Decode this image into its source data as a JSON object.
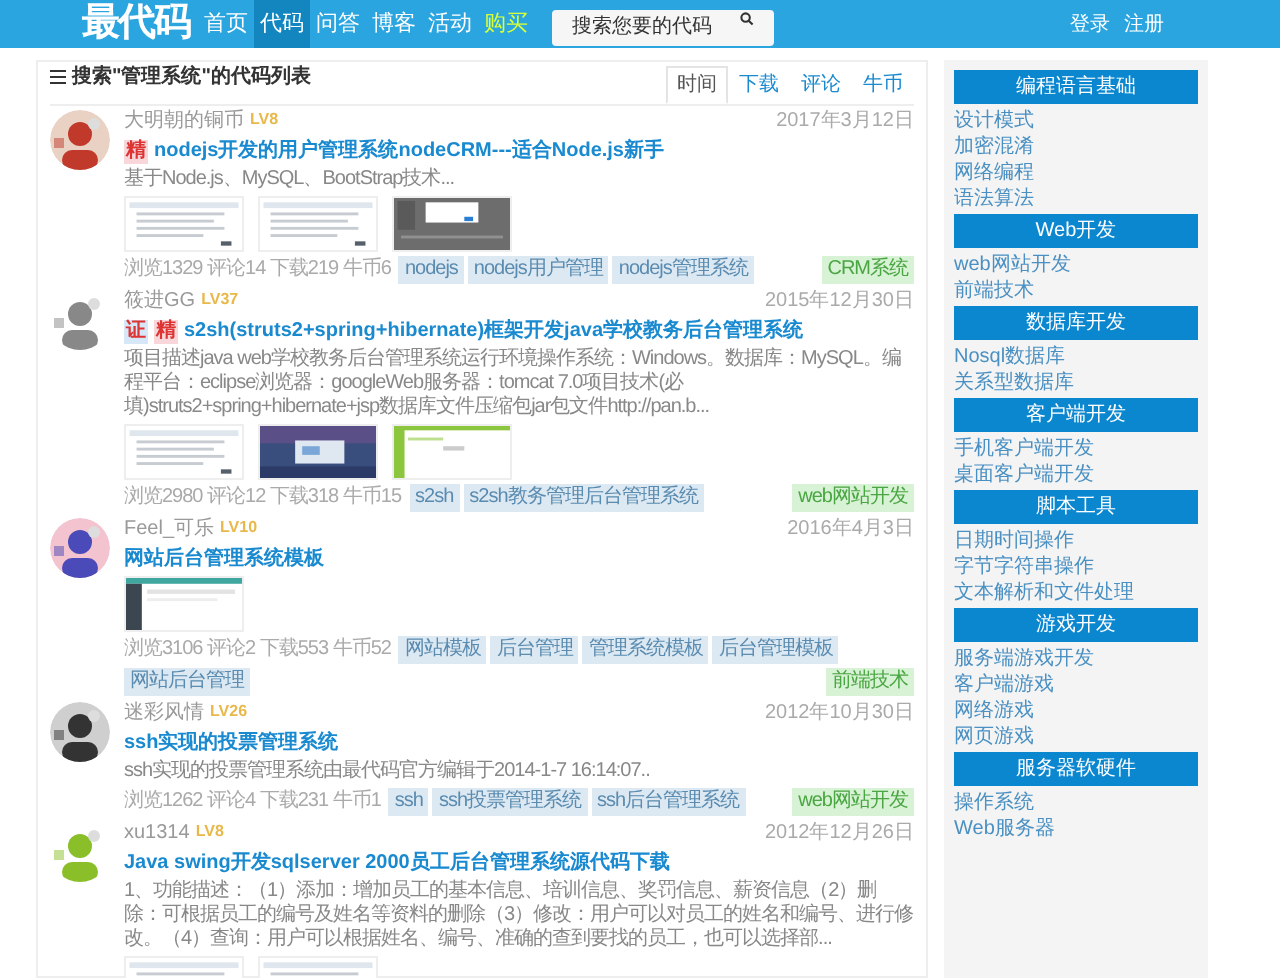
{
  "header": {
    "logo": "最代码",
    "nav": [
      {
        "label": "首页",
        "selected": false,
        "kind": "normal"
      },
      {
        "label": "代码",
        "selected": true,
        "kind": "normal"
      },
      {
        "label": "问答",
        "selected": false,
        "kind": "normal"
      },
      {
        "label": "博客",
        "selected": false,
        "kind": "normal"
      },
      {
        "label": "活动",
        "selected": false,
        "kind": "normal"
      },
      {
        "label": "购买",
        "selected": false,
        "kind": "promo"
      }
    ],
    "search": {
      "placeholder": "搜索您要的代码"
    },
    "account": [
      "登录",
      "注册"
    ]
  },
  "list": {
    "title": "搜索\"管理系统\"的代码列表",
    "sort_tabs": [
      {
        "label": "时间",
        "selected": true
      },
      {
        "label": "下载",
        "selected": false
      },
      {
        "label": "评论",
        "selected": false
      },
      {
        "label": "牛币",
        "selected": false
      }
    ],
    "items": [
      {
        "user": "大明朝的铜币",
        "level": "LV8",
        "date": "2017年3月12日",
        "badges": [
          {
            "label": "精",
            "color": "#f9d6d9"
          }
        ],
        "title": "nodejs开发的用户管理系统nodeCRM---适合Node.js新手",
        "description": "基于Node.js、MySQL、BootStrap技术...",
        "stats": "浏览1329 评论14 下载219 牛币6",
        "tags": [
          "nodejs",
          "nodejs用户管理",
          "nodejs管理系统"
        ],
        "category": "CRM系统"
      },
      {
        "user": "筱进GG",
        "level": "LV37",
        "date": "2015年12月30日",
        "badges": [
          {
            "label": "证",
            "color": "#d6e8f7"
          },
          {
            "label": "精",
            "color": "#f9d6d9"
          }
        ],
        "title": "s2sh(struts2+spring+hibernate)框架开发java学校教务后台管理系统",
        "description": "项目描述java web学校教务后台管理系统运行环境操作系统：Windows。数据库：MySQL。编程平台：eclipse浏览器：googleWeb服务器：tomcat 7.0项目技术(必填)struts2+spring+hibernate+jsp数据库文件压缩包jar包文件http://pan.b...",
        "stats": "浏览2980 评论12 下载318 牛币15",
        "tags": [
          "s2sh",
          "s2sh教务管理后台管理系统"
        ],
        "category": "web网站开发"
      },
      {
        "user": "Feel_可乐",
        "level": "LV10",
        "date": "2016年4月3日",
        "title": "网站后台管理系统模板",
        "stats": "浏览3106 评论2 下载553 牛币52",
        "tags": [
          "网站模板",
          "后台管理",
          "管理系统模板",
          "后台管理模板",
          "网站后台管理"
        ],
        "category": "前端技术"
      },
      {
        "user": "迷彩风情",
        "level": "LV26",
        "date": "2012年10月30日",
        "title": "ssh实现的投票管理系统",
        "description": "ssh实现的投票管理系统由最代码官方编辑于2014-1-7 16:14:07..",
        "stats": "浏览1262 评论4 下载231 牛币1",
        "tags": [
          "ssh",
          "ssh投票管理系统",
          "ssh后台管理系统"
        ],
        "category": "web网站开发"
      },
      {
        "user": "xu1314",
        "level": "LV8",
        "date": "2012年12月26日",
        "title": "Java swing开发sqlserver 2000员工后台管理系统源代码下载",
        "description": "1、功能描述：（1）添加：增加员工的基本信息、培训信息、奖罚信息、薪资信息（2）删除：可根据员工的编号及姓名等资料的删除（3）修改：用户可以对员工的姓名和编号、进行修改。（4）查询：用户可以根据姓名、编号、准确的查到要找的员工，也可以选择部..."
      }
    ]
  },
  "sidebar": [
    {
      "heading": "编程语言基础",
      "links": [
        "设计模式",
        "加密混淆",
        "网络编程",
        "语法算法"
      ]
    },
    {
      "heading": "Web开发",
      "links": [
        "web网站开发",
        "前端技术"
      ]
    },
    {
      "heading": "数据库开发",
      "links": [
        "Nosql数据库",
        "关系型数据库"
      ]
    },
    {
      "heading": "客户端开发",
      "links": [
        "手机客户端开发",
        "桌面客户端开发"
      ]
    },
    {
      "heading": "脚本工具",
      "links": [
        "日期时间操作",
        "字节字符串操作",
        "文本解析和文件处理"
      ]
    },
    {
      "heading": "游戏开发",
      "links": [
        "服务端游戏开发",
        "客户端游戏",
        "网络游戏",
        "网页游戏"
      ]
    },
    {
      "heading": "服务器软硬件",
      "links": [
        "操作系统",
        "Web服务器"
      ]
    }
  ]
}
